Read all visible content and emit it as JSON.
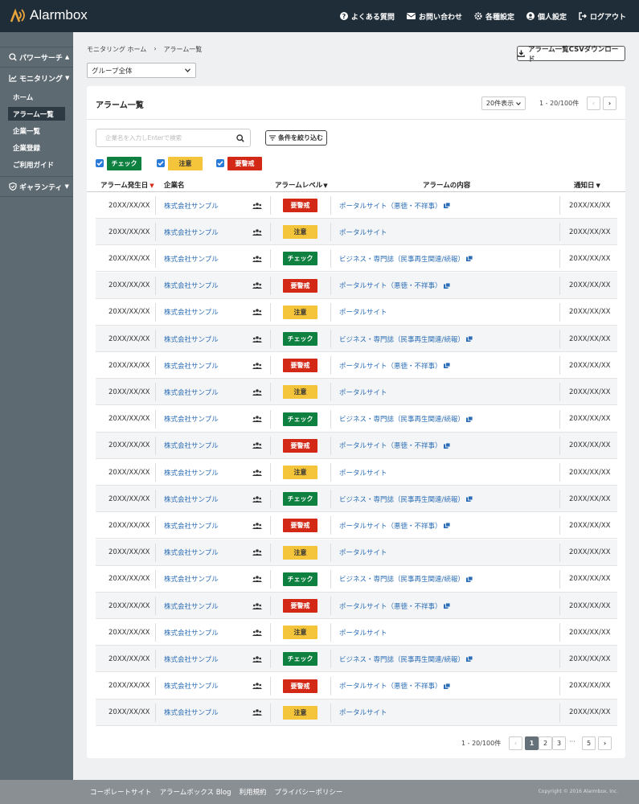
{
  "brand": {
    "name": "Alarmbox"
  },
  "topnav": [
    {
      "label": "よくある質問",
      "icon": "question-icon"
    },
    {
      "label": "お問い合わせ",
      "icon": "mail-icon"
    },
    {
      "label": "各種設定",
      "icon": "gear-icon"
    },
    {
      "label": "個人設定",
      "icon": "user-icon"
    },
    {
      "label": "ログアウト",
      "icon": "logout-icon"
    }
  ],
  "sidebar": {
    "power_search": "パワーサーチ",
    "monitoring": "モニタリング",
    "items": [
      "ホーム",
      "アラーム一覧",
      "企業一覧",
      "企業登録",
      "ご利用ガイド"
    ],
    "guarantee": "ギャランティ"
  },
  "breadcrumb": {
    "home": "モニタリング ホーム",
    "sep": "›",
    "current": "アラーム一覧"
  },
  "group_select": {
    "value": "グループ全体"
  },
  "csv_button": "アラーム一覧CSVダウンロード",
  "card": {
    "title": "アラーム一覧",
    "per_page": "20件表示",
    "range": "1 - 20/100件",
    "search_placeholder": "企業名を入力しEnterで検索",
    "filter_button": "条件を絞り込む",
    "filters": [
      {
        "label": "チェック",
        "checked": true,
        "level": "check"
      },
      {
        "label": "注意",
        "checked": true,
        "level": "warn"
      },
      {
        "label": "要警戒",
        "checked": true,
        "level": "alert"
      }
    ]
  },
  "table": {
    "headers": {
      "date": "アラーム発生日",
      "company": "企業名",
      "level": "アラームレベル",
      "content": "アラームの内容",
      "notify": "通知日"
    },
    "rows": [
      {
        "date": "20XX/XX/XX",
        "company": "株式会社サンプル",
        "level": "要警戒",
        "type": "alert",
        "content": "ポータルサイト（悪徳・不祥事）",
        "ext": true,
        "notify": "20XX/XX/XX"
      },
      {
        "date": "20XX/XX/XX",
        "company": "株式会社サンプル",
        "level": "注意",
        "type": "warn",
        "content": "ポータルサイト",
        "ext": false,
        "notify": "20XX/XX/XX"
      },
      {
        "date": "20XX/XX/XX",
        "company": "株式会社サンプル",
        "level": "チェック",
        "type": "check",
        "content": "ビジネス・専門誌（民事再生関連/続報）",
        "ext": true,
        "notify": "20XX/XX/XX"
      },
      {
        "date": "20XX/XX/XX",
        "company": "株式会社サンプル",
        "level": "要警戒",
        "type": "alert",
        "content": "ポータルサイト（悪徳・不祥事）",
        "ext": true,
        "notify": "20XX/XX/XX"
      },
      {
        "date": "20XX/XX/XX",
        "company": "株式会社サンプル",
        "level": "注意",
        "type": "warn",
        "content": "ポータルサイト",
        "ext": false,
        "notify": "20XX/XX/XX"
      },
      {
        "date": "20XX/XX/XX",
        "company": "株式会社サンプル",
        "level": "チェック",
        "type": "check",
        "content": "ビジネス・専門誌（民事再生関連/続報）",
        "ext": true,
        "notify": "20XX/XX/XX"
      },
      {
        "date": "20XX/XX/XX",
        "company": "株式会社サンプル",
        "level": "要警戒",
        "type": "alert",
        "content": "ポータルサイト（悪徳・不祥事）",
        "ext": true,
        "notify": "20XX/XX/XX"
      },
      {
        "date": "20XX/XX/XX",
        "company": "株式会社サンプル",
        "level": "注意",
        "type": "warn",
        "content": "ポータルサイト",
        "ext": false,
        "notify": "20XX/XX/XX"
      },
      {
        "date": "20XX/XX/XX",
        "company": "株式会社サンプル",
        "level": "チェック",
        "type": "check",
        "content": "ビジネス・専門誌（民事再生関連/続報）",
        "ext": true,
        "notify": "20XX/XX/XX"
      },
      {
        "date": "20XX/XX/XX",
        "company": "株式会社サンプル",
        "level": "要警戒",
        "type": "alert",
        "content": "ポータルサイト（悪徳・不祥事）",
        "ext": true,
        "notify": "20XX/XX/XX"
      },
      {
        "date": "20XX/XX/XX",
        "company": "株式会社サンプル",
        "level": "注意",
        "type": "warn",
        "content": "ポータルサイト",
        "ext": false,
        "notify": "20XX/XX/XX"
      },
      {
        "date": "20XX/XX/XX",
        "company": "株式会社サンプル",
        "level": "チェック",
        "type": "check",
        "content": "ビジネス・専門誌（民事再生関連/続報）",
        "ext": true,
        "notify": "20XX/XX/XX"
      },
      {
        "date": "20XX/XX/XX",
        "company": "株式会社サンプル",
        "level": "要警戒",
        "type": "alert",
        "content": "ポータルサイト（悪徳・不祥事）",
        "ext": true,
        "notify": "20XX/XX/XX"
      },
      {
        "date": "20XX/XX/XX",
        "company": "株式会社サンプル",
        "level": "注意",
        "type": "warn",
        "content": "ポータルサイト",
        "ext": false,
        "notify": "20XX/XX/XX"
      },
      {
        "date": "20XX/XX/XX",
        "company": "株式会社サンプル",
        "level": "チェック",
        "type": "check",
        "content": "ビジネス・専門誌（民事再生関連/続報）",
        "ext": true,
        "notify": "20XX/XX/XX"
      },
      {
        "date": "20XX/XX/XX",
        "company": "株式会社サンプル",
        "level": "要警戒",
        "type": "alert",
        "content": "ポータルサイト（悪徳・不祥事）",
        "ext": true,
        "notify": "20XX/XX/XX"
      },
      {
        "date": "20XX/XX/XX",
        "company": "株式会社サンプル",
        "level": "注意",
        "type": "warn",
        "content": "ポータルサイト",
        "ext": false,
        "notify": "20XX/XX/XX"
      },
      {
        "date": "20XX/XX/XX",
        "company": "株式会社サンプル",
        "level": "チェック",
        "type": "check",
        "content": "ビジネス・専門誌（民事再生関連/続報）",
        "ext": true,
        "notify": "20XX/XX/XX"
      },
      {
        "date": "20XX/XX/XX",
        "company": "株式会社サンプル",
        "level": "要警戒",
        "type": "alert",
        "content": "ポータルサイト（悪徳・不祥事）",
        "ext": true,
        "notify": "20XX/XX/XX"
      },
      {
        "date": "20XX/XX/XX",
        "company": "株式会社サンプル",
        "level": "注意",
        "type": "warn",
        "content": "ポータルサイト",
        "ext": false,
        "notify": "20XX/XX/XX"
      }
    ]
  },
  "pagination": {
    "range": "1 - 20/100件",
    "pages": [
      "1",
      "2",
      "3",
      "5"
    ],
    "ellipsis": "···",
    "current": "1"
  },
  "footer": {
    "links": [
      "コーポレートサイト",
      "アラームボックス Blog",
      "利用規約",
      "プライバシーポリシー"
    ],
    "copyright": "Copyright © 2016 Alarmbox, Inc."
  },
  "colors": {
    "topbar": "#1f2d38",
    "sidebar": "#5e6a72",
    "check": "#0e8040",
    "warn": "#f4c53b",
    "alert": "#d42816",
    "link": "#2a6cb5"
  }
}
